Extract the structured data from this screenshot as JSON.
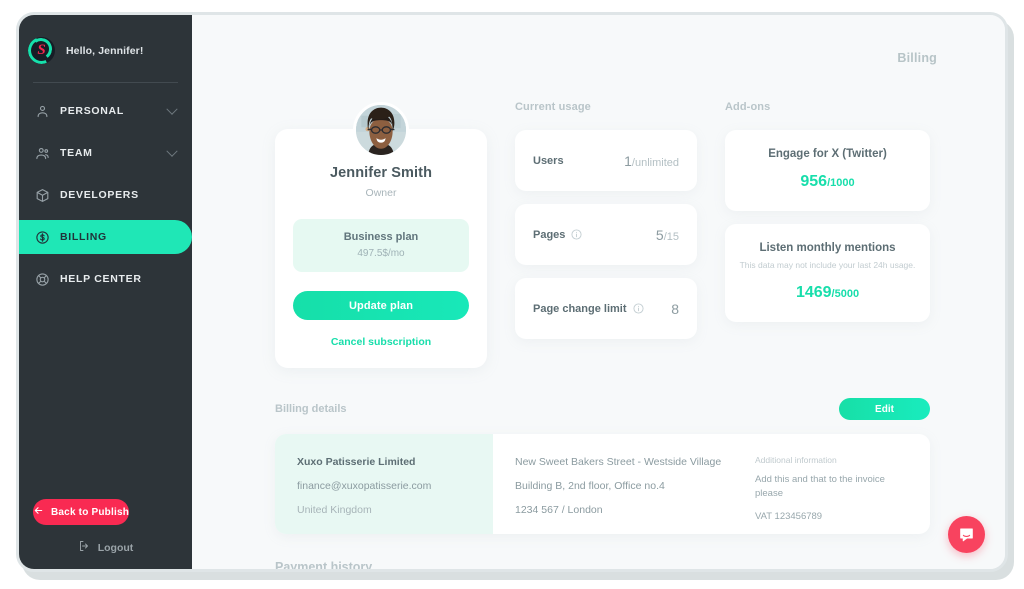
{
  "sidebar": {
    "greeting": "Hello, Jennifer!",
    "logo_letter": "S",
    "items": [
      {
        "label": "PERSONAL",
        "icon": "user-icon",
        "has_chevron": true
      },
      {
        "label": "TEAM",
        "icon": "users-icon",
        "has_chevron": true
      },
      {
        "label": "DEVELOPERS",
        "icon": "cube-icon",
        "has_chevron": false
      },
      {
        "label": "BILLING",
        "icon": "dollar-circle-icon",
        "has_chevron": false
      },
      {
        "label": "HELP CENTER",
        "icon": "lifebuoy-icon",
        "has_chevron": false
      }
    ],
    "back_to_publish": "Back to Publish",
    "logout": "Logout"
  },
  "header": {
    "title": "Billing"
  },
  "profile": {
    "name": "Jennifer Smith",
    "role": "Owner",
    "plan_name": "Business plan",
    "plan_price": "497.5$/mo",
    "update_plan_label": "Update plan",
    "cancel_label": "Cancel subscription"
  },
  "usage": {
    "heading": "Current usage",
    "items": [
      {
        "label": "Users",
        "value": "1",
        "limit": "/unlimited",
        "info": false
      },
      {
        "label": "Pages",
        "value": "5",
        "limit": "/15",
        "info": true
      },
      {
        "label": "Page change limit",
        "value": "8",
        "limit": "",
        "info": true
      }
    ]
  },
  "addons": {
    "heading": "Add-ons",
    "items": [
      {
        "title": "Engage for X (Twitter)",
        "note": "",
        "value": "956",
        "limit": "/1000"
      },
      {
        "title": "Listen monthly mentions",
        "note": "This data may not include your last 24h usage.",
        "value": "1469",
        "limit": "/5000"
      }
    ]
  },
  "billing_details": {
    "heading": "Billing details",
    "edit_label": "Edit",
    "company": {
      "name": "Xuxo Patisserie Limited",
      "email": "finance@xuxopatisserie.com",
      "country": "United Kingdom"
    },
    "address": [
      "New Sweet Bakers Street - Westside Village",
      "Building B, 2nd floor, Office no.4",
      "1234 567 / London"
    ],
    "additional": {
      "heading": "Additional information",
      "body": "Add this and that to the invoice please",
      "vat": "VAT 123456789"
    }
  },
  "payment_history": {
    "title": "Payment history"
  },
  "chat": {
    "icon": "chat-bubble-icon"
  },
  "colors": {
    "accent": "#18deab",
    "sidebar_bg": "#2d3439",
    "danger": "#f92a52",
    "page_bg": "#f7f9fa"
  }
}
